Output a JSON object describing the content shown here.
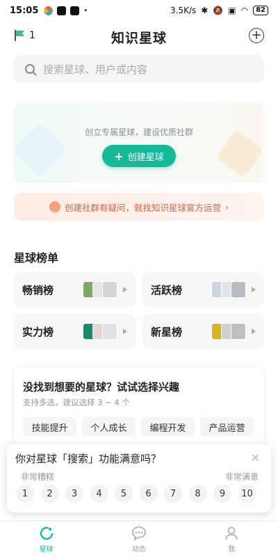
{
  "status_bar": {
    "time": "15:05",
    "network_speed": "3.5K/s",
    "battery": "82"
  },
  "header": {
    "flag_count": "1",
    "title": "知识星球"
  },
  "search": {
    "placeholder": "搜索星球、用户或内容"
  },
  "create": {
    "tagline": "创立专属星球，建设优质社群",
    "button": "创建星球"
  },
  "help_banner": {
    "text": "创建社群有疑问，就找知识星球官方运营"
  },
  "rankings": {
    "title": "星球榜单",
    "items": [
      {
        "label": "畅销榜"
      },
      {
        "label": "活跃榜"
      },
      {
        "label": "实力榜"
      },
      {
        "label": "新星榜"
      }
    ]
  },
  "interest": {
    "question": "没找到想要的星球？试试选择兴趣",
    "hint": "支持多选，建议选择 3 ~ 4 个",
    "chips": [
      "技能提升",
      "个人成长",
      "编程开发",
      "产品运营"
    ]
  },
  "survey": {
    "question": "你对星球「搜索」功能满意吗？",
    "low_label": "非常糟糕",
    "high_label": "非常满意",
    "scale": [
      "1",
      "2",
      "3",
      "4",
      "5",
      "6",
      "7",
      "8",
      "9",
      "10"
    ]
  },
  "tabbar": {
    "tabs": [
      {
        "label": "星球",
        "active": true
      },
      {
        "label": "动态",
        "active": false
      },
      {
        "label": "我",
        "active": false
      }
    ]
  },
  "colors": {
    "accent": "#16b998",
    "help_text": "#d7653f"
  }
}
